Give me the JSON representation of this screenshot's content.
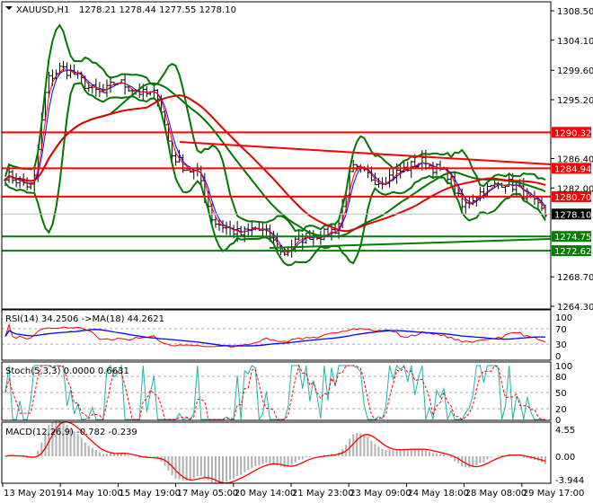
{
  "header": {
    "symbol": "XAUUSD,H1",
    "ohlc": "1278.21 1278.44 1277.55 1278.10"
  },
  "colors": {
    "bull": "#000000",
    "bands": "#007700",
    "level_red": "#ff0000",
    "level_green": "#008000",
    "rsi": "#ff0000",
    "rsi_ma": "#0000ff",
    "stoch_main": "#20b2aa",
    "stoch_signal": "#ff0000",
    "macd_hist": "#b0b0b0",
    "macd_signal": "#ff0000"
  },
  "chart_data": {
    "type": "line",
    "title": "XAUUSD,H1",
    "ylim": [
      1264.3,
      1308.5
    ],
    "price_ticks": [
      "1308.50",
      "1304.10",
      "1299.60",
      "1295.20",
      "1286.40",
      "1282.00",
      "1268.70",
      "1264.30"
    ],
    "levels": [
      {
        "label": "1290.32",
        "value": 1290.32,
        "color": "red"
      },
      {
        "label": "1284.94",
        "value": 1284.94,
        "color": "red"
      },
      {
        "label": "1280.70",
        "value": 1280.7,
        "color": "red"
      },
      {
        "label": "1278.10",
        "value": 1278.1,
        "color": "black"
      },
      {
        "label": "1274.75",
        "value": 1274.75,
        "color": "green"
      },
      {
        "label": "1272.62",
        "value": 1272.62,
        "color": "green"
      }
    ],
    "close_path": [
      1284,
      1283,
      1282,
      1298,
      1300,
      1299,
      1297,
      1296,
      1298,
      1297,
      1296,
      1296,
      1287,
      1285,
      1284,
      1277,
      1276,
      1275,
      1276,
      1275,
      1272,
      1274,
      1275,
      1275,
      1276,
      1285,
      1284,
      1283,
      1284,
      1285,
      1286,
      1285,
      1284,
      1279,
      1281,
      1282,
      1283,
      1282,
      1280,
      1278
    ],
    "x_labels": [
      "13 May 2019",
      "14 May 10:00",
      "15 May 19:00",
      "17 May 05:00",
      "20 May 14:00",
      "21 May 23:00",
      "23 May 09:00",
      "24 May 18:00",
      "28 May 08:00",
      "29 May 17:00"
    ],
    "rsi": {
      "label": "RSI(14) 34.2506  ->MA(18) 44.2621",
      "ticks": [
        "100",
        "70",
        "30",
        "0"
      ]
    },
    "stoch": {
      "label": "Stoch(5,3,3) 0.0000 0.6631",
      "ticks": [
        "100",
        "80",
        "50",
        "20",
        "0"
      ]
    },
    "macd": {
      "label": "MACD(12,26,9) -0.782 -0.239",
      "ticks": [
        "4.55",
        "0.00",
        "-3.944"
      ],
      "ylim": [
        -3.944,
        4.55
      ]
    }
  }
}
